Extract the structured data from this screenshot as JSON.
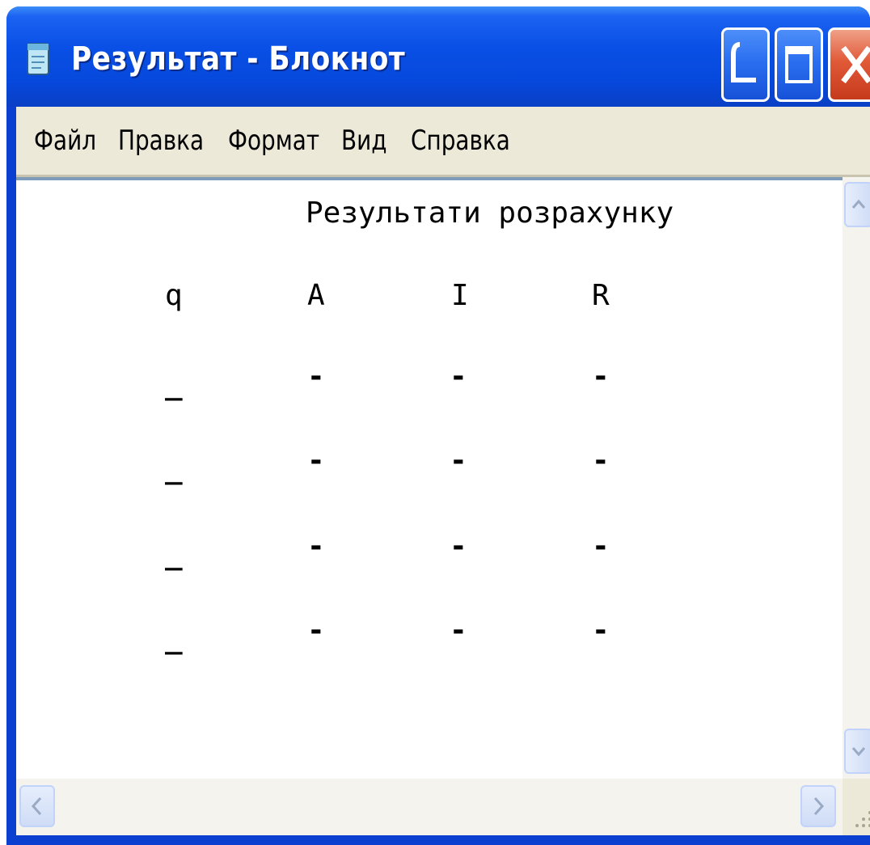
{
  "window": {
    "title": "Результат - Блокнот",
    "accent": "#0a50e6",
    "close_color": "#e05a38"
  },
  "menu": [
    "Файл",
    "Правка",
    "Формат",
    "Вид",
    "Справка"
  ],
  "document": {
    "heading": "Результати розрахунку",
    "columns": [
      "q",
      "A",
      "I",
      "R"
    ],
    "rows": [
      [
        "_",
        "-",
        "-",
        "-"
      ],
      [
        "_",
        "-",
        "-",
        "-"
      ],
      [
        "_",
        "-",
        "-",
        "-"
      ],
      [
        "_",
        "-",
        "-",
        "-"
      ]
    ]
  },
  "icons": {
    "app": "notepad-icon",
    "minimize": "minimize-icon",
    "maximize": "maximize-icon",
    "close": "close-icon",
    "scroll_up": "chevron-up-icon",
    "scroll_down": "chevron-down-icon",
    "scroll_left": "chevron-left-icon",
    "scroll_right": "chevron-right-icon",
    "resize": "resize-grip-icon"
  }
}
